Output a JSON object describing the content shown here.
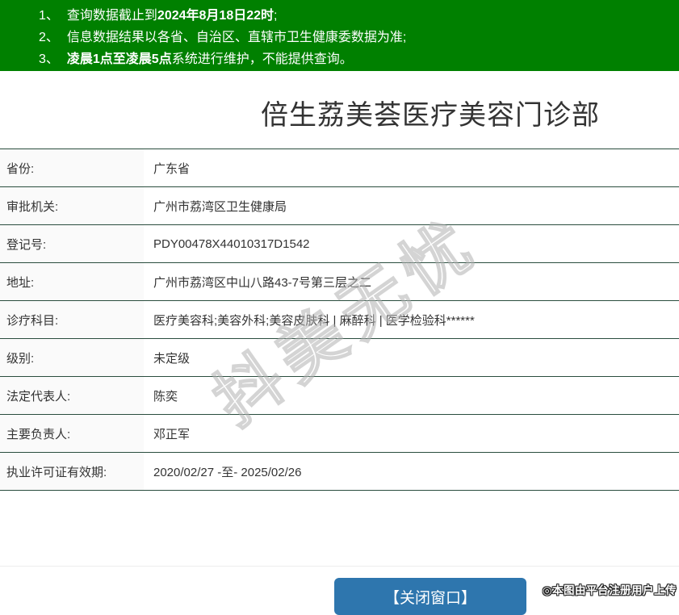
{
  "notice": {
    "bg_color": "#008000",
    "items": [
      {
        "num": "1、",
        "pre": "查询数据截止到",
        "bold": "2024年8月18日22时",
        "post": ";"
      },
      {
        "num": "2、",
        "pre": "信息数据结果以各省、自治区、直辖市卫生健康委数据为准;",
        "bold": "",
        "post": ""
      },
      {
        "num": "3、",
        "pre": "",
        "bold": "凌晨1点至凌晨5点",
        "post": "系统进行维护，不能提供查询。"
      }
    ]
  },
  "title": "倍生荔美荟医疗美容门诊部",
  "table": {
    "line_color": "#2a4d3e",
    "label_bg_color": "#fafafa",
    "rows": [
      {
        "label": "省份:",
        "value": "广东省"
      },
      {
        "label": "审批机关:",
        "value": "广州市荔湾区卫生健康局"
      },
      {
        "label": "登记号:",
        "value": "PDY00478X44010317D1542"
      },
      {
        "label": "地址:",
        "value": "广州市荔湾区中山八路43-7号第三层之二"
      },
      {
        "label": "诊疗科目:",
        "value": "医疗美容科;美容外科;美容皮肤科 | 麻醉科 | 医学检验科******"
      },
      {
        "label": "级别:",
        "value": "未定级"
      },
      {
        "label": "法定代表人:",
        "value": "陈奕"
      },
      {
        "label": "主要负责人:",
        "value": "邓正军"
      },
      {
        "label": "执业许可证有效期:",
        "value": "2020/02/27 -至- 2025/02/26"
      }
    ]
  },
  "footer": {
    "close_button_label": "【关闭窗口】",
    "button_color": "#2e76ae"
  },
  "watermark": {
    "diagonal_text": "抖美无忧",
    "attribution": "◎本图由平台注册用户上传"
  }
}
